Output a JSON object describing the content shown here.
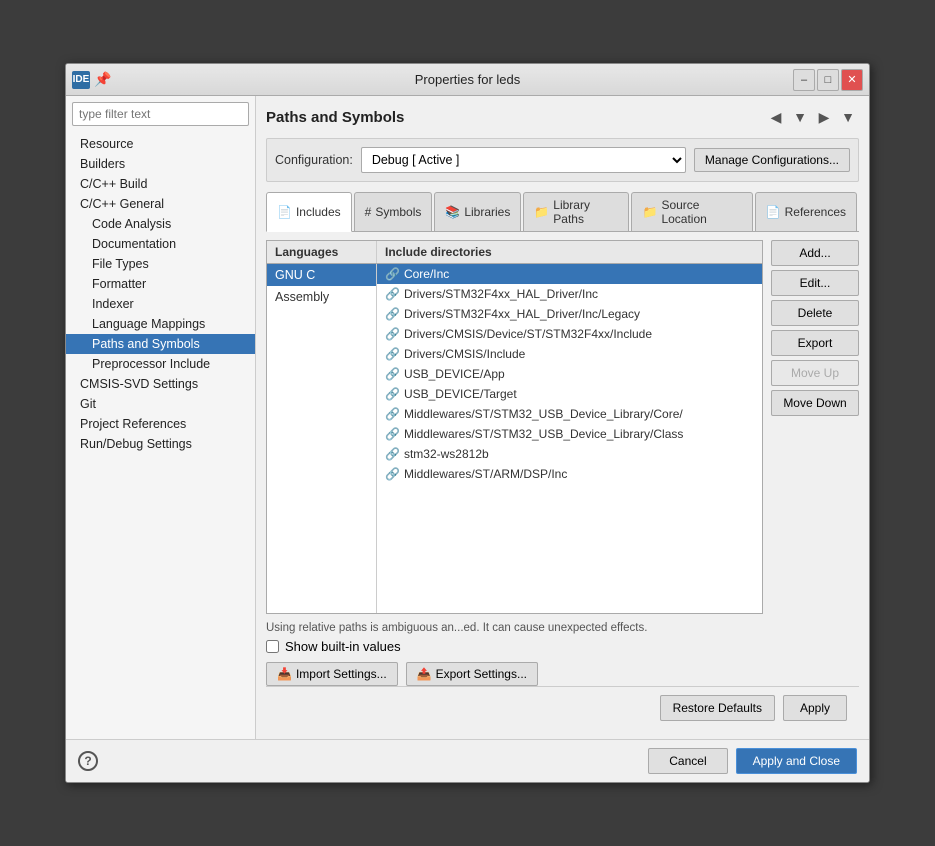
{
  "window": {
    "title": "Properties for leds",
    "ide_label": "IDE"
  },
  "sidebar": {
    "filter_placeholder": "type filter text",
    "items": [
      {
        "id": "resource",
        "label": "Resource",
        "level": 0
      },
      {
        "id": "builders",
        "label": "Builders",
        "level": 0
      },
      {
        "id": "c-cpp-build",
        "label": "C/C++ Build",
        "level": 0
      },
      {
        "id": "c-cpp-general",
        "label": "C/C++ General",
        "level": 0
      },
      {
        "id": "code-analysis",
        "label": "Code Analysis",
        "level": 1
      },
      {
        "id": "documentation",
        "label": "Documentation",
        "level": 1
      },
      {
        "id": "file-types",
        "label": "File Types",
        "level": 1
      },
      {
        "id": "formatter",
        "label": "Formatter",
        "level": 1
      },
      {
        "id": "indexer",
        "label": "Indexer",
        "level": 1
      },
      {
        "id": "language-mappings",
        "label": "Language Mappings",
        "level": 1
      },
      {
        "id": "paths-and-symbols",
        "label": "Paths and Symbols",
        "level": 1,
        "active": true
      },
      {
        "id": "preprocessor-include",
        "label": "Preprocessor Include",
        "level": 1
      },
      {
        "id": "cmsis-svd-settings",
        "label": "CMSIS-SVD Settings",
        "level": 0
      },
      {
        "id": "git",
        "label": "Git",
        "level": 0
      },
      {
        "id": "project-references",
        "label": "Project References",
        "level": 0
      },
      {
        "id": "run-debug-settings",
        "label": "Run/Debug Settings",
        "level": 0
      }
    ]
  },
  "panel": {
    "title": "Paths and Symbols",
    "configuration": {
      "label": "Configuration:",
      "value": "Debug  [ Active ]",
      "manage_btn": "Manage Configurations..."
    },
    "tabs": [
      {
        "id": "includes",
        "label": "Includes",
        "icon": "📄"
      },
      {
        "id": "symbols",
        "label": "# Symbols",
        "icon": ""
      },
      {
        "id": "libraries",
        "label": "Libraries",
        "icon": "📚"
      },
      {
        "id": "library-paths",
        "label": "Library Paths",
        "icon": "📁"
      },
      {
        "id": "source-location",
        "label": "Source Location",
        "icon": "📁"
      },
      {
        "id": "references",
        "label": "References",
        "icon": "📄"
      }
    ],
    "active_tab": "includes",
    "table": {
      "col1_header": "Languages",
      "col2_header": "Include directories",
      "languages": [
        {
          "id": "gnu-c",
          "label": "GNU C",
          "selected": true
        },
        {
          "id": "assembly",
          "label": "Assembly",
          "selected": false
        }
      ],
      "directories": [
        {
          "label": "Core/Inc",
          "selected": true
        },
        {
          "label": "Drivers/STM32F4xx_HAL_Driver/Inc",
          "selected": false
        },
        {
          "label": "Drivers/STM32F4xx_HAL_Driver/Inc/Legacy",
          "selected": false
        },
        {
          "label": "Drivers/CMSIS/Device/ST/STM32F4xx/Include",
          "selected": false
        },
        {
          "label": "Drivers/CMSIS/Include",
          "selected": false
        },
        {
          "label": "USB_DEVICE/App",
          "selected": false
        },
        {
          "label": "USB_DEVICE/Target",
          "selected": false
        },
        {
          "label": "Middlewares/ST/STM32_USB_Device_Library/Core/",
          "selected": false
        },
        {
          "label": "Middlewares/ST/STM32_USB_Device_Library/Class",
          "selected": false
        },
        {
          "label": "stm32-ws2812b",
          "selected": false
        },
        {
          "label": "Middlewares/ST/ARM/DSP/Inc",
          "selected": false
        }
      ]
    },
    "buttons": {
      "add": "Add...",
      "edit": "Edit...",
      "delete": "Delete",
      "export": "Export",
      "move_up": "Move Up",
      "move_down": "Move Down"
    },
    "info_text": "Using relative paths is ambiguous an...ed. It can cause unexpected effects.",
    "show_builtin": "Show built-in values",
    "import_btn": "Import Settings...",
    "export_btn": "Export Settings...",
    "restore_btn": "Restore Defaults",
    "apply_btn": "Apply"
  },
  "dialog": {
    "cancel_btn": "Cancel",
    "apply_close_btn": "Apply and Close"
  }
}
